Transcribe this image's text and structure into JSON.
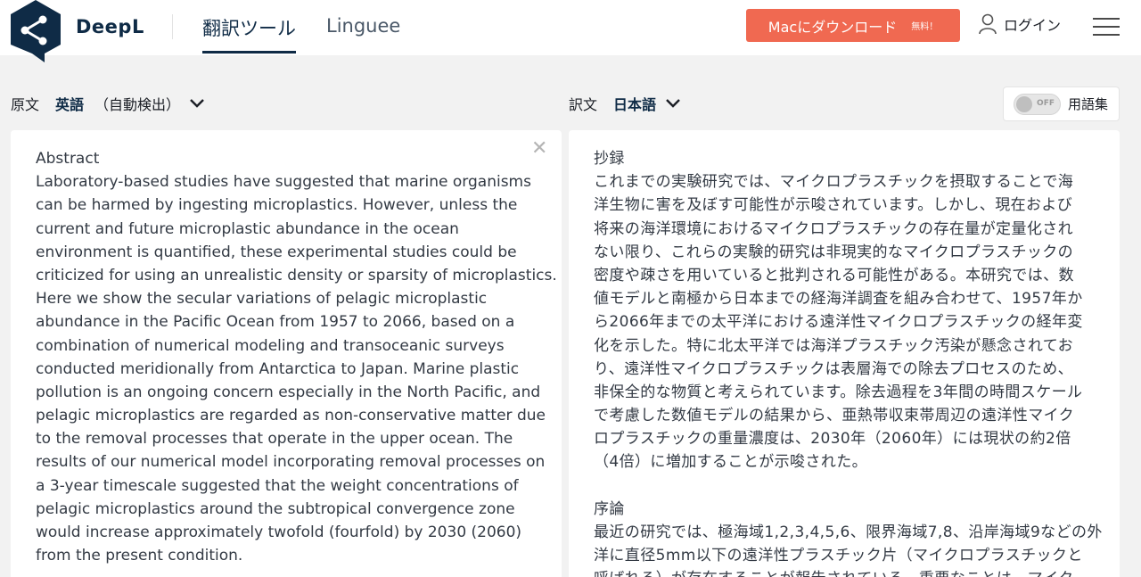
{
  "header": {
    "brand": "DeepL",
    "nav_translator": "翻訳ツール",
    "nav_linguee": "Linguee",
    "download_label": "Macにダウンロード",
    "download_sub": "無料！",
    "login_label": "ログイン"
  },
  "source": {
    "label": "原文",
    "language": "英語",
    "auto": "（自動検出）",
    "lines": [
      "Abstract",
      "Laboratory-based studies have suggested that marine organisms",
      "can be harmed by ingesting microplastics. However, unless the",
      "current and future microplastic abundance in the ocean",
      "environment is quantified, these experimental studies could be",
      "criticized for using an unrealistic density or sparsity of microplastics.",
      "Here we show the secular variations of pelagic microplastic",
      "abundance in the Pacific Ocean from 1957 to 2066, based on a",
      "combination of numerical modeling and transoceanic surveys",
      "conducted meridionally from Antarctica to Japan. Marine plastic",
      "pollution is an ongoing concern especially in the North Pacific, and",
      "pelagic microplastics are regarded as non-conservative matter due",
      "to the removal processes that operate in the upper ocean. The",
      "results of our numerical model incorporating removal processes on",
      "a 3-year timescale suggested that the weight concentrations of",
      "pelagic microplastics around the subtropical convergence zone",
      "would increase approximately twofold (fourfold) by 2030 (2060)",
      "from the present condition."
    ]
  },
  "target": {
    "label": "訳文",
    "language": "日本語",
    "glossary_state": "OFF",
    "glossary_label": "用語集",
    "lines": [
      "抄録",
      "これまでの実験研究では、マイクロプラスチックを摂取することで海",
      "洋生物に害を及ぼす可能性が示唆されています。しかし、現在および",
      "将来の海洋環境におけるマイクロプラスチックの存在量が定量化され",
      "ない限り、これらの実験的研究は非現実的なマイクロプラスチックの",
      "密度や疎さを用いていると批判される可能性がある。本研究では、数",
      "値モデルと南極から日本までの経海洋調査を組み合わせて、1957年か",
      "ら2066年までの太平洋における遠洋性マイクロプラスチックの経年変",
      "化を示した。特に北太平洋では海洋プラスチック汚染が懸念されてお",
      "り、遠洋性マイクロプラスチックは表層海での除去プロセスのため、",
      "非保全的な物質と考えられています。除去過程を3年間の時間スケール",
      "で考慮した数値モデルの結果から、亜熱帯収束帯周辺の遠洋性マイク",
      "ロプラスチックの重量濃度は、2030年（2060年）には現状の約2倍",
      "（4倍）に増加することが示唆された。",
      "",
      "序論",
      "最近の研究では、極海域1,2,3,4,5,6、限界海域7,8、沿岸海域9などの外",
      "洋に直径5mm以下の遠洋性プラスチック片（マイクロプラスチックと",
      "呼ばれる）が存在することが報告されている。重要なことは、マイク"
    ]
  }
}
